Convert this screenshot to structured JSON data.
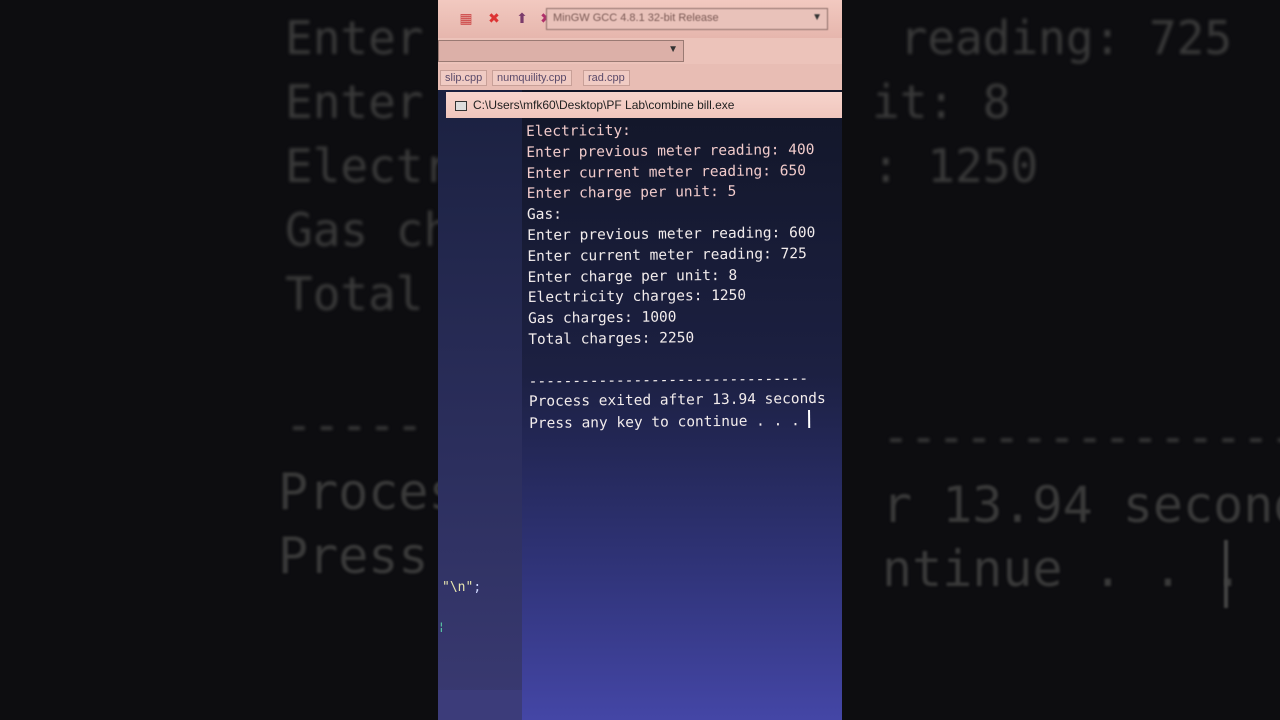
{
  "background": {
    "left_lines": [
      "Enter",
      "Enter",
      "Electr",
      "Gas ch",
      "Total"
    ],
    "right_lines": [
      " reading: 725",
      "it: 8",
      ": 1250",
      "",
      ""
    ],
    "left_dashes": "-----",
    "right_dashes": "---------------",
    "left_bottom": [
      "Proces",
      "Press"
    ],
    "right_bottom": [
      "r 13.94 seconds",
      "ntinue . . ."
    ]
  },
  "ide": {
    "compiler": "MinGW GCC 4.8.1 32-bit Release",
    "tabs": [
      "slip.cpp",
      "numquility.cpp",
      "rad.cpp"
    ],
    "code_snippet": "\"\\n\"",
    "code_semi": ";"
  },
  "console": {
    "title": "C:\\Users\\mfk60\\Desktop\\PF Lab\\combine bill.exe",
    "lines": [
      "Electricity:",
      "Enter previous meter reading: 400",
      "Enter current meter reading: 650",
      "Enter charge per unit: 5",
      "Gas:",
      "Enter previous meter reading: 600",
      "Enter current meter reading: 725",
      "Enter charge per unit: 8",
      "Electricity charges: 1250",
      "Gas charges: 1000",
      "Total charges: 2250",
      "",
      "--------------------------------",
      "Process exited after 13.94 seconds",
      "Press any key to continue . . . "
    ]
  },
  "colors": {
    "console_text": "#f2ecec",
    "toolbar_bg": "#f2c9c0",
    "console_bg_bottom": "#4446a6"
  }
}
